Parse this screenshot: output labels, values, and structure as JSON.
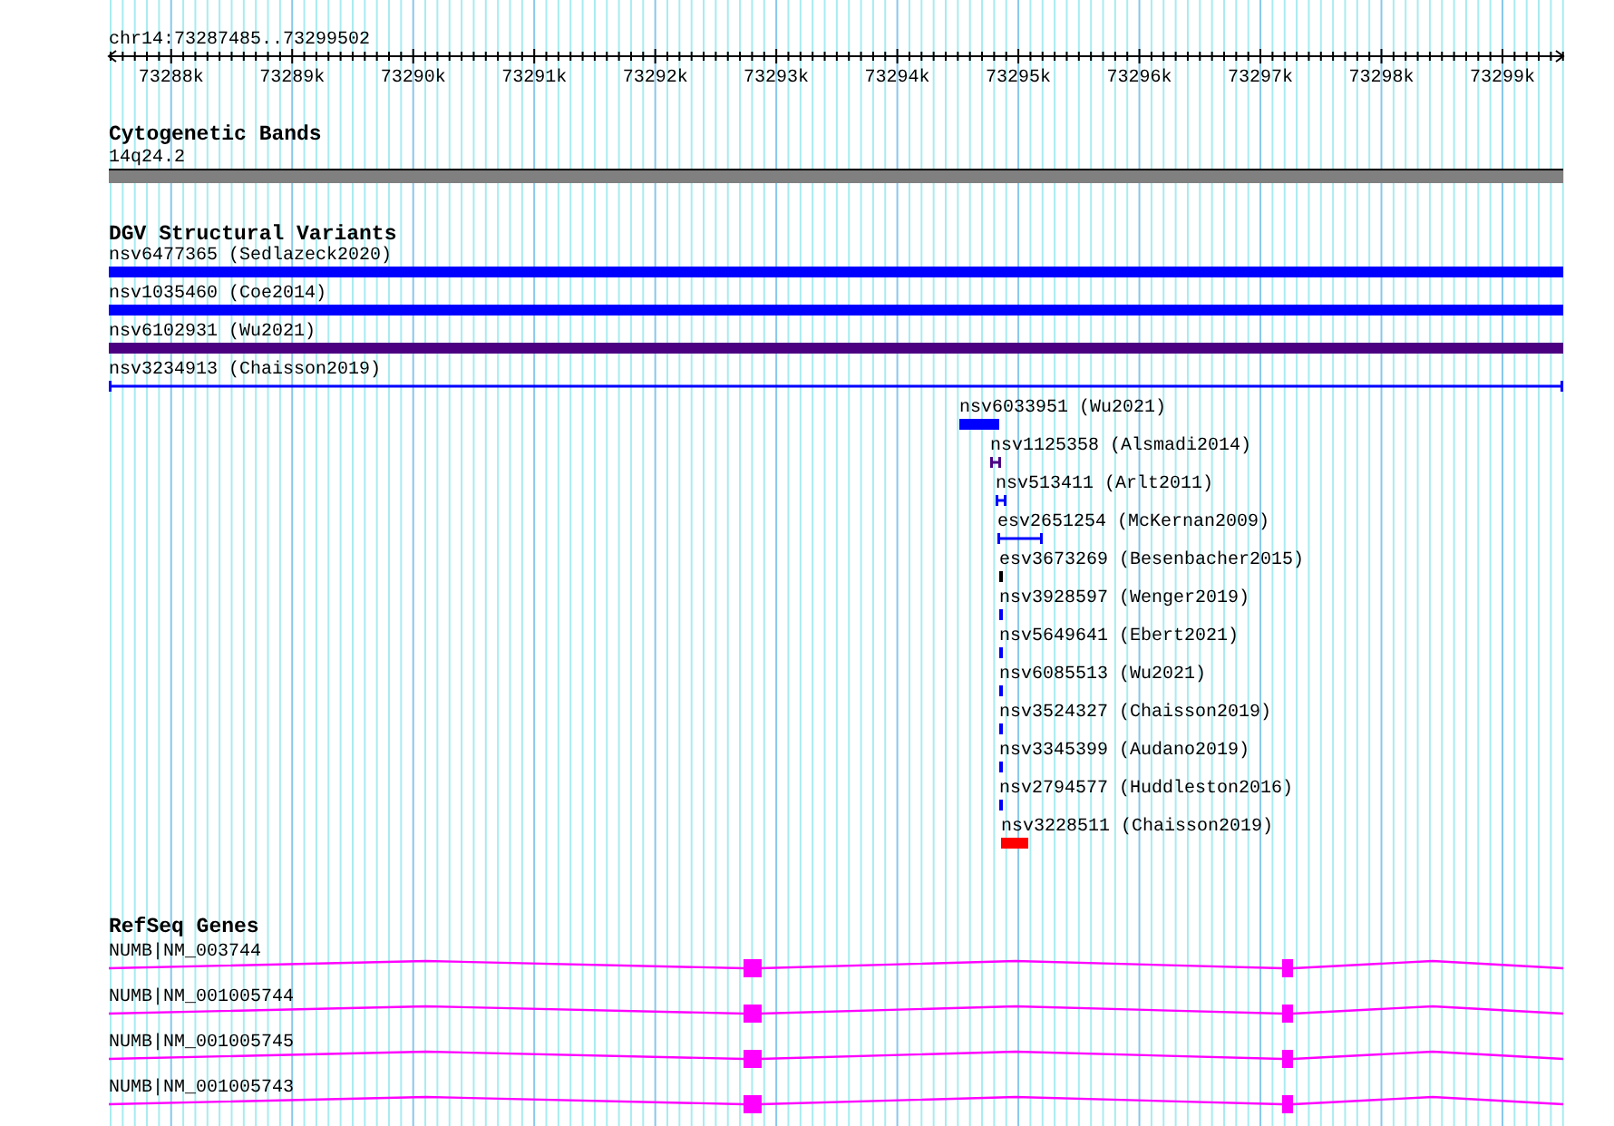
{
  "locus": "chr14:73287485..73299502",
  "ruler": {
    "ticks": [
      "73288k",
      "73289k",
      "73290k",
      "73291k",
      "73292k",
      "73293k",
      "73294k",
      "73295k",
      "73296k",
      "73297k",
      "73298k",
      "73299k"
    ]
  },
  "tracks": [
    {
      "title": "Cytogenetic Bands",
      "kind": "cytoband",
      "features": [
        {
          "label": "14q24.2",
          "color": "#808080"
        }
      ]
    },
    {
      "title": "DGV Structural Variants",
      "kind": "variants",
      "features": [
        {
          "label": "nsv6477365 (Sedlazeck2020)",
          "kind": "bar",
          "color": "#0000ff"
        },
        {
          "label": "nsv1035460 (Coe2014)",
          "kind": "bar",
          "color": "#0000ff"
        },
        {
          "label": "nsv6102931 (Wu2021)",
          "kind": "bar",
          "color": "#4b0082"
        },
        {
          "label": "nsv3234913 (Chaisson2019)",
          "kind": "span",
          "color": "#0000ff"
        },
        {
          "label": "nsv6033951 (Wu2021)",
          "kind": "bar",
          "color": "#0000ff"
        },
        {
          "label": "nsv1125358 (Alsmadi2014)",
          "kind": "span",
          "color": "#4b0082"
        },
        {
          "label": "nsv513411 (Arlt2011)",
          "kind": "span",
          "color": "#0000ff"
        },
        {
          "label": "esv2651254 (McKernan2009)",
          "kind": "span",
          "color": "#0000ff"
        },
        {
          "label": "esv3673269 (Besenbacher2015)",
          "kind": "bar",
          "color": "#000000"
        },
        {
          "label": "nsv3928597 (Wenger2019)",
          "kind": "bar",
          "color": "#0000ff"
        },
        {
          "label": "nsv5649641 (Ebert2021)",
          "kind": "bar",
          "color": "#0000ff"
        },
        {
          "label": "nsv6085513 (Wu2021)",
          "kind": "bar",
          "color": "#0000ff"
        },
        {
          "label": "nsv3524327 (Chaisson2019)",
          "kind": "bar",
          "color": "#0000ff"
        },
        {
          "label": "nsv3345399 (Audano2019)",
          "kind": "bar",
          "color": "#0000ff"
        },
        {
          "label": "nsv2794577 (Huddleston2016)",
          "kind": "bar",
          "color": "#0000ff"
        },
        {
          "label": "nsv3228511 (Chaisson2019)",
          "kind": "bar",
          "color": "#ff0000"
        }
      ]
    },
    {
      "title": "RefSeq Genes",
      "kind": "genes",
      "features": [
        {
          "label": "NUMB|NM_003744",
          "color": "#ff00ff"
        },
        {
          "label": "NUMB|NM_001005744",
          "color": "#ff00ff"
        },
        {
          "label": "NUMB|NM_001005745",
          "color": "#ff00ff"
        },
        {
          "label": "NUMB|NM_001005743",
          "color": "#ff00ff"
        }
      ]
    }
  ]
}
